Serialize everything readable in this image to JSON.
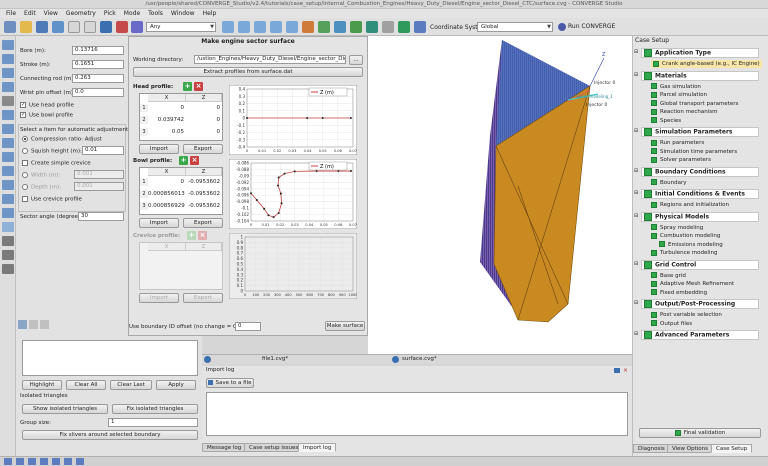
{
  "window": {
    "title": "/usr/people/shared/CONVERGE_Studio/v2.4/tutorials/case_setup/Internal_Combustion_Engines/Heavy_Duty_Diesel/Engine_sector_Diesel_CTC/surface.cvg - CONVERGE Studio"
  },
  "menu": [
    "File",
    "Edit",
    "View",
    "Geometry",
    "Pick",
    "Mode",
    "Tools",
    "Window",
    "Help"
  ],
  "toolbar": {
    "select_mode": "Any",
    "coord_label": "Coordinate System:",
    "coord_value": "Global",
    "run_label": "Run CONVERGE"
  },
  "engine_params": {
    "bore_label": "Bore (m):",
    "bore": "0.13716",
    "stroke_label": "Stroke (m):",
    "stroke": "0.1651",
    "rod_label": "Connecting rod (m):",
    "rod": "0.263",
    "wrist_label": "Wrist pin offset (m):",
    "wrist": "0.0",
    "use_head": "Use head profile",
    "use_bowl": "Use bowl profile",
    "adjust_title": "Select a item for automatic adjustment",
    "compression": "Compression ratio:",
    "compression_mode": "Adjust",
    "squish_label": "Squish height (m):",
    "squish": "0.01",
    "simple_crevice": "Create simple crevice",
    "width_label": "Width (m):",
    "width": "0.001",
    "depth_label": "Depth (m):",
    "depth": "0.001",
    "use_crevice": "Use crevice profile",
    "sector_label": "Sector angle (degree):",
    "sector": "30"
  },
  "dialog": {
    "title": "Make engine sector surface",
    "workdir_label": "Working directory:",
    "workdir": "/ustion_Engines/Heavy_Duty_Diesel/Engine_sector_Diesel_CTC",
    "browse": "...",
    "extract": "Extract profiles from surface.dat",
    "head_title": "Head profile:",
    "col_x": "X",
    "col_z": "Z",
    "head_rows": [
      {
        "n": "1",
        "x": "0",
        "z": "0"
      },
      {
        "n": "2",
        "x": "0.039742",
        "z": "0"
      },
      {
        "n": "3",
        "x": "0.05",
        "z": "0"
      }
    ],
    "import": "Import",
    "export": "Export",
    "bowl_title": "Bowl profile:",
    "bowl_rows": [
      {
        "n": "1",
        "x": "0",
        "z": "-0.0953602"
      },
      {
        "n": "2",
        "x": "0.000856013",
        "z": "-0.0953602"
      },
      {
        "n": "3",
        "x": "0.000856929",
        "z": "-0.0953602"
      }
    ],
    "crevice_title": "Crevice profile:",
    "offset_label": "Use boundary ID offset (no change = 0):",
    "offset": "0",
    "make_surface": "Make surface"
  },
  "head_chart": {
    "legend": "Z (m)",
    "yticks": [
      "0.4",
      "0.3",
      "0.2",
      "0.1",
      "0",
      "-0.1",
      "-0.2",
      "-0.3",
      "-0.4"
    ],
    "xticks": [
      "0",
      "0.01",
      "0.02",
      "0.03",
      "0.04",
      "0.05",
      "0.06",
      "0.07"
    ],
    "points": [
      [
        0,
        0
      ],
      [
        0.039742,
        0
      ],
      [
        0.05,
        0
      ],
      [
        0.0686,
        0
      ]
    ],
    "xlim": [
      0,
      0.07
    ],
    "ylim": [
      -0.4,
      0.4
    ]
  },
  "bowl_chart": {
    "legend": "Z (m)",
    "yticks": [
      "-0.086",
      "-0.088",
      "-0.09",
      "-0.092",
      "-0.094",
      "-0.096",
      "-0.098",
      "-0.1",
      "-0.102",
      "-0.104"
    ],
    "xticks": [
      "0",
      "0.01",
      "0.02",
      "0.03",
      "0.04",
      "0.05",
      "0.06",
      "0.07"
    ],
    "points": [
      [
        0,
        -0.0954
      ],
      [
        0.004,
        -0.0975
      ],
      [
        0.009,
        -0.1002
      ],
      [
        0.012,
        -0.1022
      ],
      [
        0.0155,
        -0.1028
      ],
      [
        0.019,
        -0.1015
      ],
      [
        0.021,
        -0.0985
      ],
      [
        0.0205,
        -0.0955
      ],
      [
        0.0185,
        -0.093
      ],
      [
        0.019,
        -0.0905
      ],
      [
        0.023,
        -0.0893
      ],
      [
        0.03,
        -0.0886
      ],
      [
        0.045,
        -0.0885
      ],
      [
        0.06,
        -0.0885
      ],
      [
        0.0686,
        -0.0885
      ]
    ],
    "xlim": [
      0,
      0.07
    ],
    "ylim": [
      -0.104,
      -0.086
    ]
  },
  "crevice_chart": {
    "yticks": [
      "1",
      "0.9",
      "0.8",
      "0.7",
      "0.6",
      "0.5",
      "0.4",
      "0.3",
      "0.2",
      "0.1",
      "0"
    ],
    "xticks": [
      "0",
      "100",
      "200",
      "300",
      "400",
      "500",
      "600",
      "700",
      "800",
      "900",
      "1000"
    ]
  },
  "viewport": {
    "injector_top": "Injector 0",
    "injector_side": "Injector 0",
    "spray": "Spray_modeling_1",
    "axis_z": "Z"
  },
  "case_setup": {
    "title": "Case Setup",
    "sections": [
      {
        "head": "Application Type",
        "items": [
          "Crank angle-based (e.g., IC Engine)"
        ]
      },
      {
        "head": "Materials",
        "items": [
          "Gas simulation",
          "Parcel simulation",
          "Global transport parameters",
          "Reaction mechanism",
          "Species"
        ]
      },
      {
        "head": "Simulation Parameters",
        "items": [
          "Run parameters",
          "Simulation time parameters",
          "Solver parameters"
        ]
      },
      {
        "head": "Boundary Conditions",
        "items": [
          "Boundary"
        ]
      },
      {
        "head": "Initial Conditions & Events",
        "items": [
          "Regions and initialization"
        ]
      },
      {
        "head": "Physical Models",
        "items": [
          "Spray modeling",
          "Combustion modeling",
          "Emissions modeling",
          "Turbulence modeling"
        ]
      },
      {
        "head": "Grid Control",
        "items": [
          "Base grid",
          "Adaptive Mesh Refinement",
          "Fixed embedding"
        ]
      },
      {
        "head": "Output/Post-Processing",
        "items": [
          "Post variable selection",
          "Output files"
        ]
      },
      {
        "head": "Advanced Parameters",
        "items": []
      }
    ],
    "final_validation": "Final validation",
    "tabs": [
      "Diagnosis",
      "View Options",
      "Case Setup"
    ]
  },
  "bottom_left": {
    "highlight": "Highlight",
    "clear_all": "Clear All",
    "clear_last": "Clear Last",
    "apply": "Apply",
    "isolated_title": "Isolated triangles",
    "show_isolated": "Show isolated triangles",
    "fix_isolated": "Fix isolated triangles",
    "group_label": "Group size:",
    "group_value": "1",
    "fix_slivers": "Fix slivers around selected boundary"
  },
  "files": {
    "file1": "file1.cvg*",
    "surface": "surface.cvg*"
  },
  "log": {
    "title": "Import log",
    "save": "Save to a file",
    "tabs": [
      "Message log",
      "Case setup issues",
      "Import log"
    ]
  }
}
